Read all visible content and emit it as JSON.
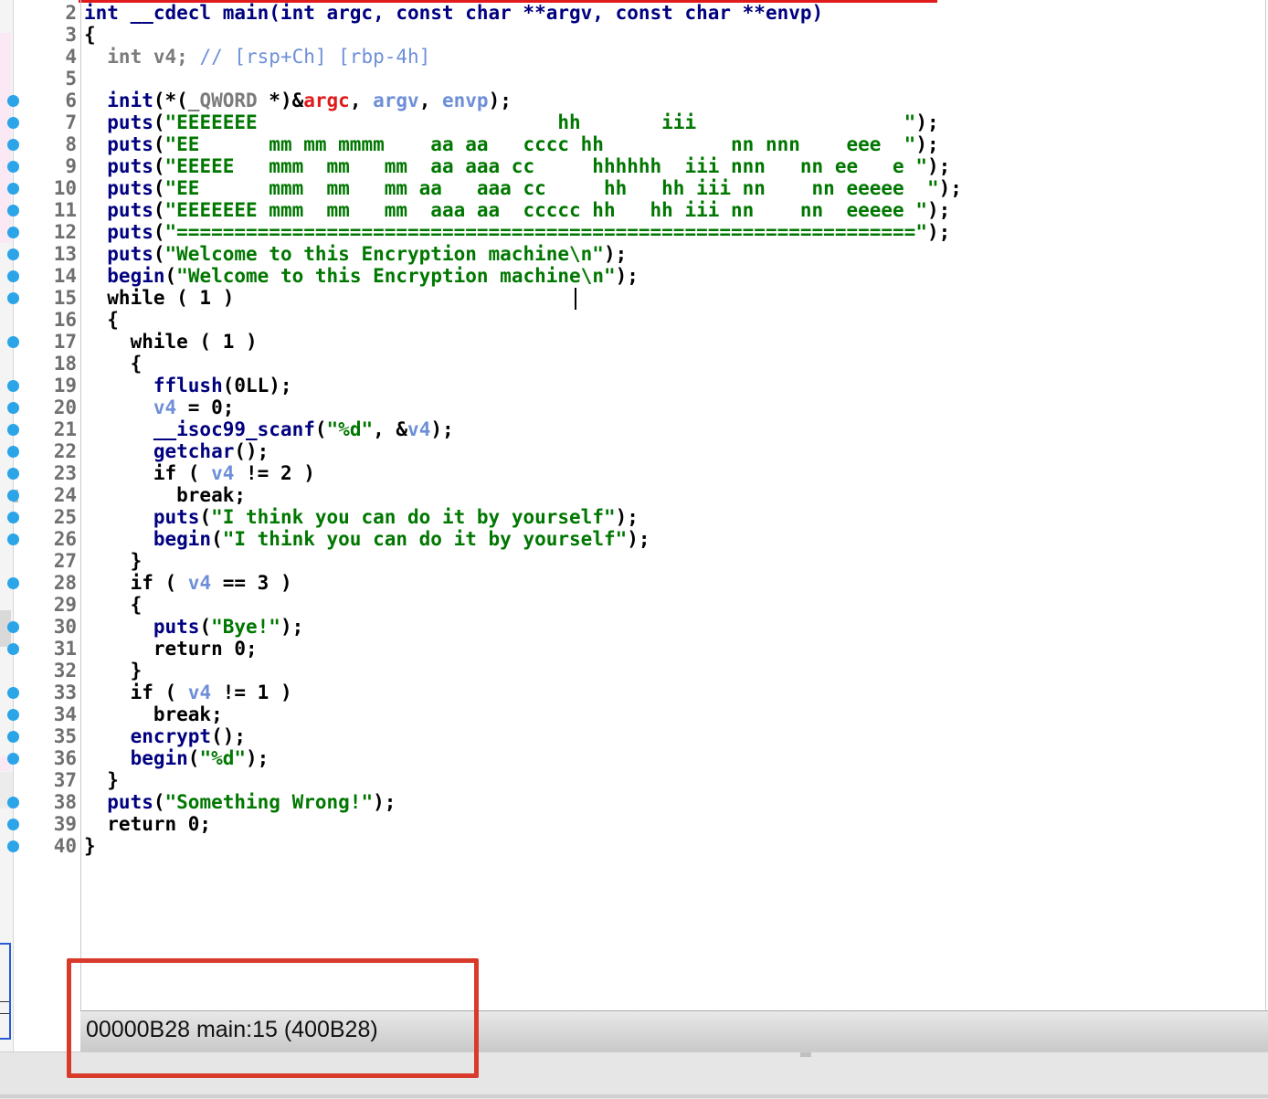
{
  "colors": {
    "keyword": "#000080",
    "string": "#007700",
    "variable": "#6e8fd8",
    "parameter": "#e01b1b",
    "breakpoint_dot": "#2ba4e8",
    "annotation_box": "#d83a2c"
  },
  "code": {
    "lines": [
      {
        "n": "2",
        "dot": false,
        "segs": [
          [
            "k",
            "int __cdecl main(int argc, const char **argv, const char **envp)"
          ]
        ]
      },
      {
        "n": "3",
        "dot": false,
        "segs": [
          [
            "t",
            "{"
          ]
        ]
      },
      {
        "n": "4",
        "dot": false,
        "segs": [
          [
            "g",
            "  int v4; "
          ],
          [
            "c",
            "// [rsp+Ch] [rbp-4h]"
          ]
        ]
      },
      {
        "n": "5",
        "dot": false,
        "segs": []
      },
      {
        "n": "6",
        "dot": true,
        "segs": [
          [
            "k",
            "  init"
          ],
          [
            "t",
            "(*("
          ],
          [
            "g",
            "_QWORD"
          ],
          [
            "t",
            " *)&"
          ],
          [
            "r",
            "argc"
          ],
          [
            "t",
            ", "
          ],
          [
            "v",
            "argv"
          ],
          [
            "t",
            ", "
          ],
          [
            "v",
            "envp"
          ],
          [
            "t",
            ");"
          ]
        ]
      },
      {
        "n": "7",
        "dot": true,
        "segs": [
          [
            "k",
            "  puts"
          ],
          [
            "t",
            "("
          ],
          [
            "s",
            "\"EEEEEEE                          hh       iii                  \""
          ],
          [
            "t",
            ");"
          ]
        ]
      },
      {
        "n": "8",
        "dot": true,
        "segs": [
          [
            "k",
            "  puts"
          ],
          [
            "t",
            "("
          ],
          [
            "s",
            "\"EE      mm mm mmmm    aa aa   cccc hh           nn nnn    eee  \""
          ],
          [
            "t",
            ");"
          ]
        ]
      },
      {
        "n": "9",
        "dot": true,
        "segs": [
          [
            "k",
            "  puts"
          ],
          [
            "t",
            "("
          ],
          [
            "s",
            "\"EEEEE   mmm  mm   mm  aa aaa cc     hhhhhh  iii nnn   nn ee   e \""
          ],
          [
            "t",
            ");"
          ]
        ]
      },
      {
        "n": "10",
        "dot": true,
        "segs": [
          [
            "k",
            "  puts"
          ],
          [
            "t",
            "("
          ],
          [
            "s",
            "\"EE      mmm  mm   mm aa   aaa cc     hh   hh iii nn    nn eeeee  \""
          ],
          [
            "t",
            ");"
          ]
        ]
      },
      {
        "n": "11",
        "dot": true,
        "segs": [
          [
            "k",
            "  puts"
          ],
          [
            "t",
            "("
          ],
          [
            "s",
            "\"EEEEEEE mmm  mm   mm  aaa aa  ccccc hh   hh iii nn    nn  eeeee \""
          ],
          [
            "t",
            ");"
          ]
        ]
      },
      {
        "n": "12",
        "dot": true,
        "segs": [
          [
            "k",
            "  puts"
          ],
          [
            "t",
            "("
          ],
          [
            "s",
            "\"================================================================\""
          ],
          [
            "t",
            ");"
          ]
        ]
      },
      {
        "n": "13",
        "dot": true,
        "segs": [
          [
            "k",
            "  puts"
          ],
          [
            "t",
            "("
          ],
          [
            "s",
            "\"Welcome to this Encryption machine\\n\""
          ],
          [
            "t",
            ");"
          ]
        ]
      },
      {
        "n": "14",
        "dot": true,
        "segs": [
          [
            "k",
            "  begin"
          ],
          [
            "t",
            "("
          ],
          [
            "s",
            "\"Welcome to this Encryption machine\\n\""
          ],
          [
            "t",
            ");"
          ]
        ]
      },
      {
        "n": "15",
        "dot": true,
        "segs": [
          [
            "t",
            "  while ( 1 )"
          ]
        ]
      },
      {
        "n": "16",
        "dot": false,
        "segs": [
          [
            "t",
            "  {"
          ]
        ]
      },
      {
        "n": "17",
        "dot": true,
        "segs": [
          [
            "t",
            "    while ( 1 )"
          ]
        ]
      },
      {
        "n": "18",
        "dot": false,
        "segs": [
          [
            "t",
            "    {"
          ]
        ]
      },
      {
        "n": "19",
        "dot": true,
        "segs": [
          [
            "k",
            "      fflush"
          ],
          [
            "t",
            "(0LL);"
          ]
        ]
      },
      {
        "n": "20",
        "dot": true,
        "segs": [
          [
            "v",
            "      v4"
          ],
          [
            "t",
            " = 0;"
          ]
        ]
      },
      {
        "n": "21",
        "dot": true,
        "segs": [
          [
            "k",
            "      __isoc99_scanf"
          ],
          [
            "t",
            "("
          ],
          [
            "s",
            "\"%d\""
          ],
          [
            "t",
            ", &"
          ],
          [
            "v",
            "v4"
          ],
          [
            "t",
            ");"
          ]
        ]
      },
      {
        "n": "22",
        "dot": true,
        "segs": [
          [
            "k",
            "      getchar"
          ],
          [
            "t",
            "();"
          ]
        ]
      },
      {
        "n": "23",
        "dot": true,
        "segs": [
          [
            "t",
            "      if ( "
          ],
          [
            "v",
            "v4"
          ],
          [
            "t",
            " != 2 )"
          ]
        ]
      },
      {
        "n": "24",
        "dot": true,
        "segs": [
          [
            "t",
            "        break;"
          ]
        ]
      },
      {
        "n": "25",
        "dot": true,
        "segs": [
          [
            "k",
            "      puts"
          ],
          [
            "t",
            "("
          ],
          [
            "s",
            "\"I think you can do it by yourself\""
          ],
          [
            "t",
            ");"
          ]
        ]
      },
      {
        "n": "26",
        "dot": true,
        "segs": [
          [
            "k",
            "      begin"
          ],
          [
            "t",
            "("
          ],
          [
            "s",
            "\"I think you can do it by yourself\""
          ],
          [
            "t",
            ");"
          ]
        ]
      },
      {
        "n": "27",
        "dot": false,
        "segs": [
          [
            "t",
            "    }"
          ]
        ]
      },
      {
        "n": "28",
        "dot": true,
        "segs": [
          [
            "t",
            "    if ( "
          ],
          [
            "v",
            "v4"
          ],
          [
            "t",
            " == 3 )"
          ]
        ]
      },
      {
        "n": "29",
        "dot": false,
        "segs": [
          [
            "t",
            "    {"
          ]
        ]
      },
      {
        "n": "30",
        "dot": true,
        "segs": [
          [
            "k",
            "      puts"
          ],
          [
            "t",
            "("
          ],
          [
            "s",
            "\"Bye!\""
          ],
          [
            "t",
            ");"
          ]
        ]
      },
      {
        "n": "31",
        "dot": true,
        "segs": [
          [
            "t",
            "      return 0;"
          ]
        ]
      },
      {
        "n": "32",
        "dot": false,
        "segs": [
          [
            "t",
            "    }"
          ]
        ]
      },
      {
        "n": "33",
        "dot": true,
        "segs": [
          [
            "t",
            "    if ( "
          ],
          [
            "v",
            "v4"
          ],
          [
            "t",
            " != 1 )"
          ]
        ]
      },
      {
        "n": "34",
        "dot": true,
        "segs": [
          [
            "t",
            "      break;"
          ]
        ]
      },
      {
        "n": "35",
        "dot": true,
        "segs": [
          [
            "k",
            "    encrypt"
          ],
          [
            "t",
            "();"
          ]
        ]
      },
      {
        "n": "36",
        "dot": true,
        "segs": [
          [
            "k",
            "    begin"
          ],
          [
            "t",
            "("
          ],
          [
            "s",
            "\"%d\""
          ],
          [
            "t",
            ");"
          ]
        ]
      },
      {
        "n": "37",
        "dot": false,
        "segs": [
          [
            "t",
            "  }"
          ]
        ]
      },
      {
        "n": "38",
        "dot": true,
        "segs": [
          [
            "k",
            "  puts"
          ],
          [
            "t",
            "("
          ],
          [
            "s",
            "\"Something Wrong!\""
          ],
          [
            "t",
            ");"
          ]
        ]
      },
      {
        "n": "39",
        "dot": true,
        "segs": [
          [
            "t",
            "  return 0;"
          ]
        ]
      },
      {
        "n": "40",
        "dot": true,
        "segs": [
          [
            "t",
            "}"
          ]
        ]
      }
    ]
  },
  "status": {
    "location": "00000B28  main:15 (400B28)"
  }
}
